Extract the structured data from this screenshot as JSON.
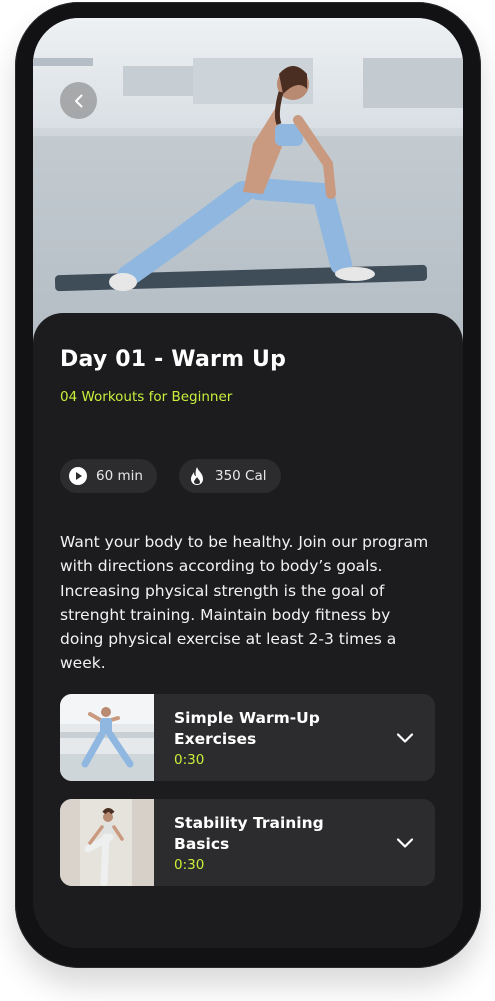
{
  "workout": {
    "title": "Day 01 - Warm Up",
    "subtitle": "04 Workouts for Beginner",
    "duration": "60 min",
    "calories": "350 Cal",
    "description": "Want your body to be healthy. Join our program with directions according to body’s goals. Increasing physical strength is the goal of strenght training. Maintain body fitness by doing physical exercise at least 2-3 times a week."
  },
  "exercises": [
    {
      "title": "Simple Warm-Up Exercises",
      "time": "0:30"
    },
    {
      "title": "Stability Training Basics",
      "time": "0:30"
    }
  ],
  "colors": {
    "accent": "#c8f03c",
    "background": "#1c1c1e",
    "card": "#2c2c2e",
    "text": "#ffffff"
  },
  "icons": {
    "back": "chevron-left-icon",
    "duration": "play-circle-icon",
    "calories": "flame-icon",
    "expand": "chevron-down-icon"
  }
}
